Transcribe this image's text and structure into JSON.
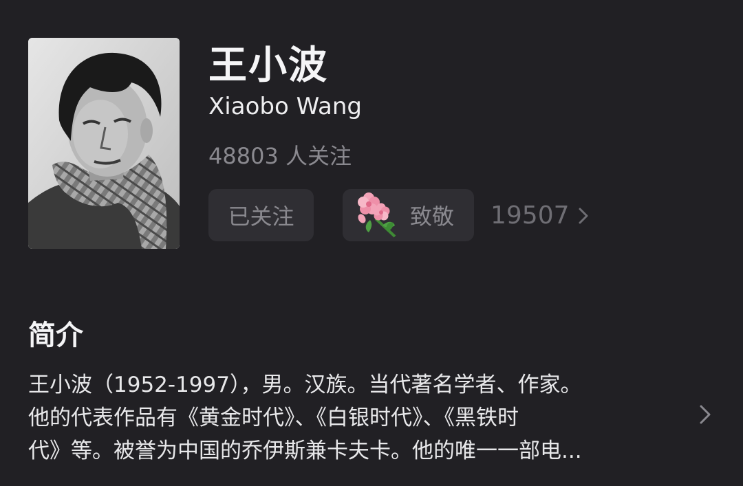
{
  "profile": {
    "name_cn": "王小波",
    "name_en": "Xiaobo Wang",
    "followers": "48803 人关注"
  },
  "actions": {
    "follow_label": "已关注",
    "salute_label": "致敬",
    "salute_icon": "flower-icon",
    "salute_count": "19507"
  },
  "intro": {
    "heading": "简介",
    "lines": [
      "王小波（1952-1997），男。汉族。当代著名学者、作家。",
      "他的代表作品有《黄金时代》、《白银时代》、《黑铁时",
      "代》等。被誉为中国的乔伊斯兼卡夫卡。他的唯一一部电..."
    ]
  },
  "colors": {
    "background": "#212024",
    "button_bg": "#2f2e33",
    "muted_text": "#8a898f",
    "primary_text": "#f5f5f7"
  }
}
